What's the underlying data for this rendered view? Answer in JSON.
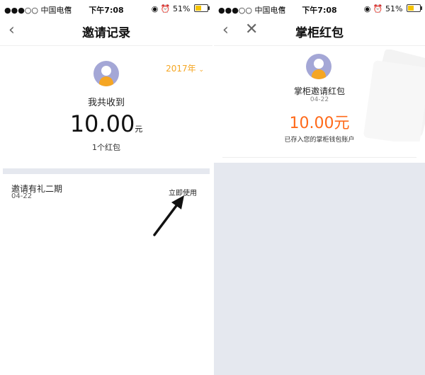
{
  "left": {
    "status": {
      "carrier": "●●●○○ 中国电信",
      "time": "下午7:08",
      "battery": "51%"
    },
    "nav": {
      "title": "邀请记录",
      "back": "‹"
    },
    "year_selector": "2017年",
    "received_label": "我共收到",
    "amount": "10.00",
    "amount_unit": "元",
    "count": "1个红包",
    "item": {
      "title": "邀请有礼二期",
      "date": "04-22",
      "action": "立即使用"
    }
  },
  "right": {
    "status": {
      "carrier": "●●●○○ 中国电信",
      "time": "下午7:08",
      "battery": "51%"
    },
    "nav": {
      "title": "掌柜红包",
      "back": "‹",
      "close": "✕"
    },
    "title": "掌柜邀请红包",
    "date": "04-22",
    "amount": "10.00元",
    "note": "已存入您的掌柜钱包账户",
    "colors": {
      "amount": "#ff6a1a",
      "accent": "#f5a623"
    }
  }
}
